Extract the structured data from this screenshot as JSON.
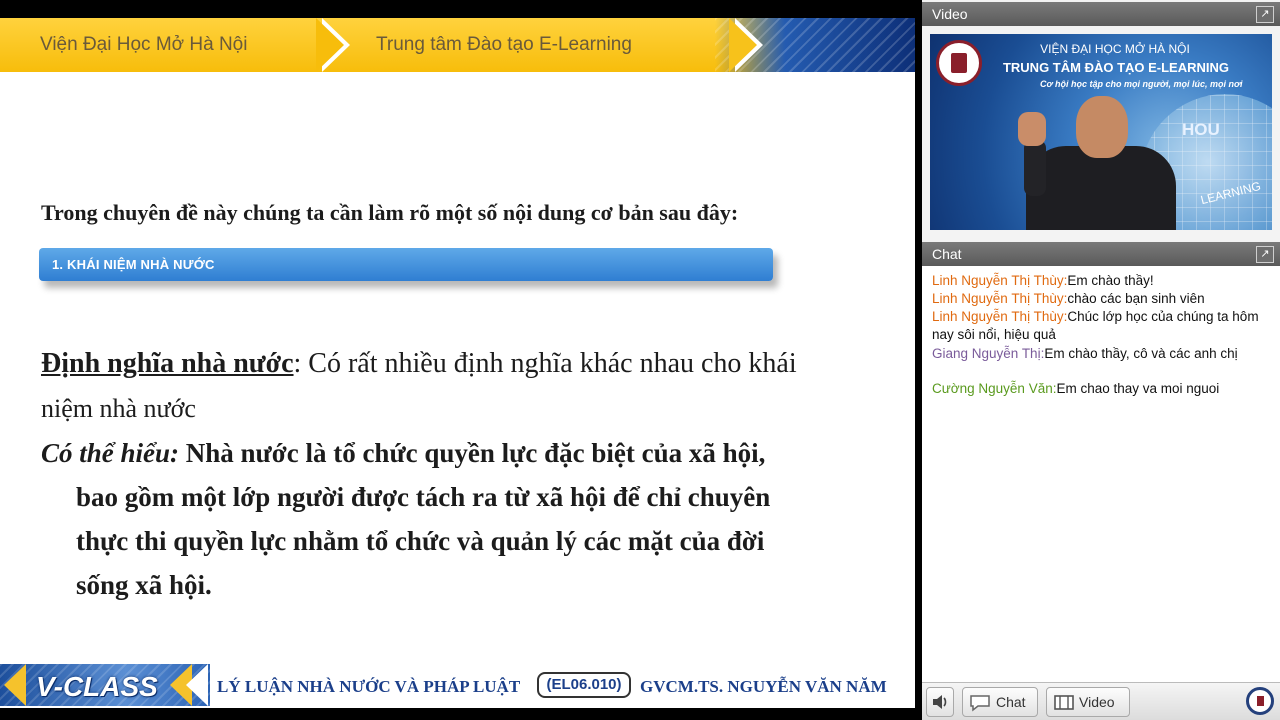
{
  "slide": {
    "header": {
      "left": "Viện Đại Học Mở Hà Nội",
      "right": "Trung tâm Đào tạo E-Learning"
    },
    "intro": "Trong chuyên đề này chúng ta cần làm rõ một số nội dung cơ bản sau đây:",
    "section_label": "1. KHÁI NIỆM NHÀ NƯỚC",
    "definition_term": "Định nghĩa nhà nước",
    "definition_rest": ": Có rất nhiều định nghĩa khác nhau cho khái",
    "definition_line2": "niệm nhà nước",
    "understand_lead": "Có thể hiểu:",
    "understand_line1": " Nhà nước là tổ chức quyền lực đặc biệt của xã hội,",
    "understand_line2": "bao gồm một lớp người được tách ra từ xã hội để chỉ chuyên",
    "understand_line3": "thực thi quyền lực nhằm tổ chức và quản lý các mặt của đời",
    "understand_line4": "sống xã hội.",
    "footer": {
      "logo": "V-CLASS",
      "course": "LÝ LUẬN NHÀ NƯỚC VÀ PHÁP LUẬT",
      "code": "(EL06.010)",
      "lecturer": "GVCM.TS. NGUYỄN VĂN NĂM"
    }
  },
  "video_panel": {
    "title": "Video",
    "line1": "VIỆN ĐẠI HỌC MỞ HÀ NỘI",
    "line2": "TRUNG TÂM ĐÀO TẠO E-LEARNING",
    "line3": "Cơ hội học tập cho mọi người, mọi lúc, mọi nơi",
    "brand": "HOU",
    "learning": "LEARNING"
  },
  "chat_panel": {
    "title": "Chat",
    "messages": [
      {
        "user": "Linh Nguyễn Thị Thùy:",
        "text": "Em chào thầy!",
        "color": "#e06a10"
      },
      {
        "user": "Linh Nguyễn Thị Thùy:",
        "text": "chào các bạn sinh viên",
        "color": "#e06a10"
      },
      {
        "user": "Linh Nguyễn Thị Thùy:",
        "text": "Chúc lớp học của chúng ta hôm nay sôi nổi, hiệu quả",
        "color": "#e06a10"
      },
      {
        "user": "Giang Nguyễn Thị:",
        "text": "Em chào thầy, cô và các anh chị",
        "color": "#7a5b9a"
      },
      {
        "user": "Cường Nguyễn Văn:",
        "text": "Em chao thay va moi nguoi",
        "color": "#5a9a1e"
      }
    ]
  },
  "bottom_bar": {
    "chat_button": "Chat",
    "video_button": "Video"
  }
}
